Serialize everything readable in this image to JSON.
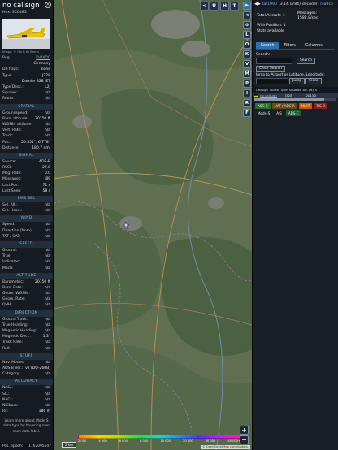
{
  "sidebar": {
    "callsign": "no callsign",
    "hex": "Hex: 3C6483",
    "photo_credit": "Image: © Chris de Breun",
    "basic": [
      {
        "k": "Reg.:",
        "v": "D-BADC",
        "link": true
      },
      {
        "k": "",
        "v": "Germany"
      },
      {
        "k": "DB flags:",
        "v": "none"
      },
      {
        "k": "Type:",
        "v": "J328"
      },
      {
        "k": "",
        "v": "Dornier 328 JET"
      },
      {
        "k": "Type Desc.:",
        "v": "L2J"
      },
      {
        "k": "Squawk:",
        "v": "n/a"
      },
      {
        "k": "Route:",
        "v": "n/a"
      }
    ],
    "sections": [
      {
        "title": "SPATIAL",
        "rows": [
          {
            "k": "Groundspeed:",
            "v": "n/a"
          },
          {
            "k": "Baro. altitude:",
            "v": "20150 ft"
          },
          {
            "k": "WGS84 altitude:",
            "v": "n/a"
          },
          {
            "k": "Vert. Rate:",
            "v": "n/a"
          },
          {
            "k": "Track:",
            "v": "n/a"
          },
          {
            "k": "Pos.:",
            "v": "50.554°, 6.778°"
          },
          {
            "k": "Distance:",
            "v": "180.7 nmi"
          }
        ]
      },
      {
        "title": "SIGNAL",
        "rows": [
          {
            "k": "Source:",
            "v": "ADS-B"
          },
          {
            "k": "RSSI:",
            "v": "-27.8"
          },
          {
            "k": "Msg. Rate:",
            "v": "0.0"
          },
          {
            "k": "Messages:",
            "v": "89"
          },
          {
            "k": "Last Pos.:",
            "v": "71 s"
          },
          {
            "k": "Last Seen:",
            "v": "58 s"
          }
        ]
      },
      {
        "title": "FMS SEL",
        "rows": [
          {
            "k": "Sel. Alt.:",
            "v": "n/a"
          },
          {
            "k": "Sel. Head.:",
            "v": "n/a"
          }
        ]
      },
      {
        "title": "WIND",
        "rows": [
          {
            "k": "Speed:",
            "v": "n/a"
          },
          {
            "k": "Direction (from):",
            "v": "n/a"
          },
          {
            "k": "TAT / OAT:",
            "v": "n/a"
          }
        ]
      },
      {
        "title": "SPEED",
        "rows": [
          {
            "k": "Ground:",
            "v": "n/a"
          },
          {
            "k": "True:",
            "v": "n/a"
          },
          {
            "k": "Indicated:",
            "v": "n/a"
          },
          {
            "k": "Mach:",
            "v": "n/a"
          }
        ]
      },
      {
        "title": "ALTITUDE",
        "rows": [
          {
            "k": "Barometric:",
            "v": "20150 ft"
          },
          {
            "k": "Baro. Rate:",
            "v": "n/a"
          },
          {
            "k": "Geom. WGS84:",
            "v": "n/a"
          },
          {
            "k": "Geom. Rate:",
            "v": "n/a"
          },
          {
            "k": "QNH:",
            "v": "n/a"
          }
        ]
      },
      {
        "title": "DIRECTION",
        "rows": [
          {
            "k": "Ground Track:",
            "v": "n/a"
          },
          {
            "k": "True Heading:",
            "v": "n/a"
          },
          {
            "k": "Magnetic Heading:",
            "v": "n/a"
          },
          {
            "k": "Magnetic Decl.:",
            "v": "1.3°"
          },
          {
            "k": "Track Rate:",
            "v": "n/a"
          },
          {
            "k": "Roll:",
            "v": "n/a"
          }
        ]
      },
      {
        "title": "STUFF",
        "rows": [
          {
            "k": "Nav. Modes:",
            "v": "n/a"
          },
          {
            "k": "ADS-B Ver.:",
            "v": "v2 (DO-260B)"
          },
          {
            "k": "Category:",
            "v": "n/a"
          }
        ]
      },
      {
        "title": "ACCURACY",
        "rows": [
          {
            "k": "NACₚ:",
            "v": "n/a"
          },
          {
            "k": "SIL:",
            "v": "n/a"
          },
          {
            "k": "NACᵥ:",
            "v": "n/a"
          },
          {
            "k": "NICbaro:",
            "v": "n/a"
          },
          {
            "k": "Rc:",
            "v": "186 m"
          }
        ]
      }
    ],
    "note": "Learn more about Mode S data type by hovering over each data label.",
    "pos_epoch_label": "Pos. epoch:",
    "pos_epoch_value": "1762095647"
  },
  "map": {
    "top_buttons": [
      "<",
      "U",
      "H",
      "T"
    ],
    "zoom_in": "+",
    "zoom_out": "−",
    "scale": "2 km",
    "altitude_labels": [
      "2 000",
      "4 000",
      "6 000",
      "8 000",
      "10 000",
      "20 000",
      "30 000",
      "40 000+"
    ],
    "attribution": "© OpenStreetMap contributors."
  },
  "layers": {
    "buttons": [
      "▶",
      "<",
      "⊙",
      "L",
      "O",
      "K",
      "V",
      "M",
      "P",
      "I",
      "R",
      "F"
    ]
  },
  "panel": {
    "arrows": "◀▶",
    "version": "tar1090",
    "version_num": "(3.14.1784)",
    "decoder_label": "decoder:",
    "decoder_value": "readsb",
    "total_label": "Total Aircraft:",
    "total_value": "1",
    "messages_label": "Messages:",
    "messages_value": "1582.8/sec",
    "withpos_label": "With Position:",
    "withpos_value": "1",
    "stats_label": "Stats available",
    "tabs": [
      "Search",
      "Filters",
      "Columns"
    ],
    "search_label": "Search:",
    "search_button": "Search",
    "clear_button": "Clear Search",
    "jump_label": "Jump to Airport or Latitude, Longitude:",
    "jump_button": "Jump",
    "clear2_button": "Clear",
    "columns": [
      "Callsign",
      "Route",
      "Type",
      "Squawk",
      "Alt. (ft)",
      "S"
    ],
    "row": {
      "callsign": "no callsign",
      "type": "J328",
      "alt": "20150"
    },
    "filter_chips": [
      {
        "label": "ADS-B",
        "color": "#2c6e2f"
      },
      {
        "label": "UAT / ADS-R",
        "color": "#6b4a10"
      },
      {
        "label": "MLAT",
        "color": "#c05a00"
      },
      {
        "label": "TIS-B",
        "color": "#8a1f1f"
      },
      {
        "label": "Mode-S",
        "color": "#1a1f26"
      },
      {
        "label": "AIS",
        "color": "#1a1f26"
      },
      {
        "label": "ADS-C",
        "color": "#1f5a35"
      }
    ]
  }
}
